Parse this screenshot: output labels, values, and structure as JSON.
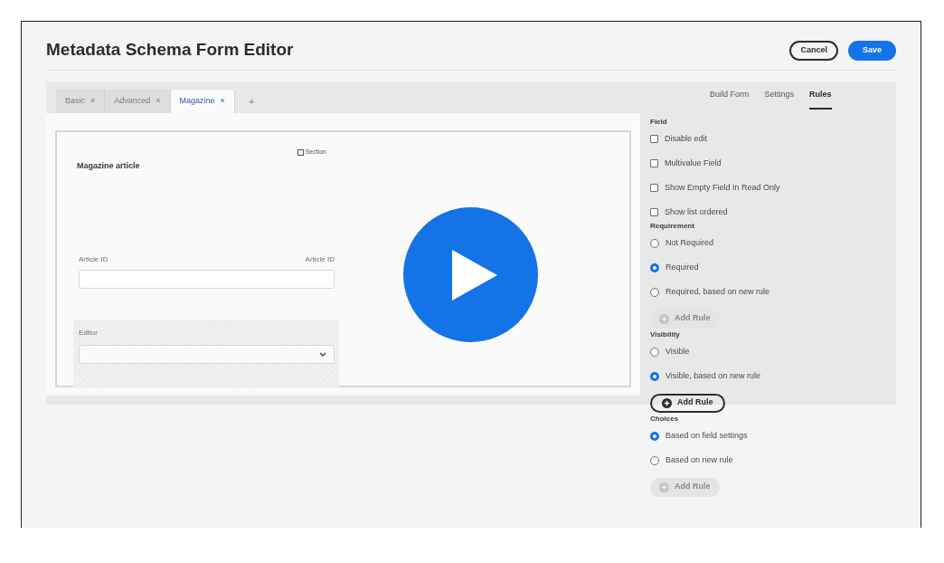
{
  "title": "Metadata Schema Form Editor",
  "actions": [
    {
      "label": "Cancel",
      "kind": "secondary"
    },
    {
      "label": "Save",
      "kind": "primary"
    }
  ],
  "tabs": [
    {
      "label": "Basic",
      "selected": false
    },
    {
      "label": "Advanced",
      "selected": false
    },
    {
      "label": "Magazine",
      "selected": true
    }
  ],
  "tab_close": "×",
  "add_tab": "+",
  "nav": [
    {
      "label": "Build Form",
      "selected": false
    },
    {
      "label": "Settings",
      "selected": false
    },
    {
      "label": "Rules",
      "selected": true
    }
  ],
  "form": {
    "title": "Magazine article",
    "section": {
      "label": "Section",
      "checked": false
    },
    "fields": [
      {
        "kind": "text",
        "label": "Article ID",
        "label_right": "Article ID"
      },
      {
        "kind": "select",
        "label": "Editor"
      }
    ]
  },
  "rules": [
    {
      "heading": "Field",
      "items": [
        {
          "kind": "checkbox",
          "label": "Disable edit",
          "checked": false
        },
        {
          "kind": "checkbox",
          "label": "Multivalue Field",
          "checked": false
        },
        {
          "kind": "checkbox",
          "label": "Show Empty Field In Read Only",
          "checked": false
        },
        {
          "kind": "checkbox",
          "label": "Show list ordered",
          "checked": false
        }
      ]
    },
    {
      "heading": "Requirement",
      "items": [
        {
          "kind": "radio",
          "label": "Not Required",
          "selected": false
        },
        {
          "kind": "radio",
          "label": "Required",
          "selected": true
        },
        {
          "kind": "radio",
          "label": "Required, based on new rule",
          "selected": false
        },
        {
          "kind": "button",
          "label": "Add Rule",
          "disabled": true
        }
      ]
    },
    {
      "heading": "Visibility",
      "items": [
        {
          "kind": "radio",
          "label": "Visible",
          "selected": false
        },
        {
          "kind": "radio",
          "label": "Visible, based on new rule",
          "selected": true
        },
        {
          "kind": "button",
          "label": "Add Rule",
          "disabled": false
        }
      ]
    },
    {
      "heading": "Choices",
      "items": [
        {
          "kind": "radio",
          "label": "Based on field settings",
          "selected": true
        },
        {
          "kind": "radio",
          "label": "Based on new rule",
          "selected": false
        },
        {
          "kind": "button",
          "label": "Add Rule",
          "disabled": true
        }
      ]
    }
  ]
}
